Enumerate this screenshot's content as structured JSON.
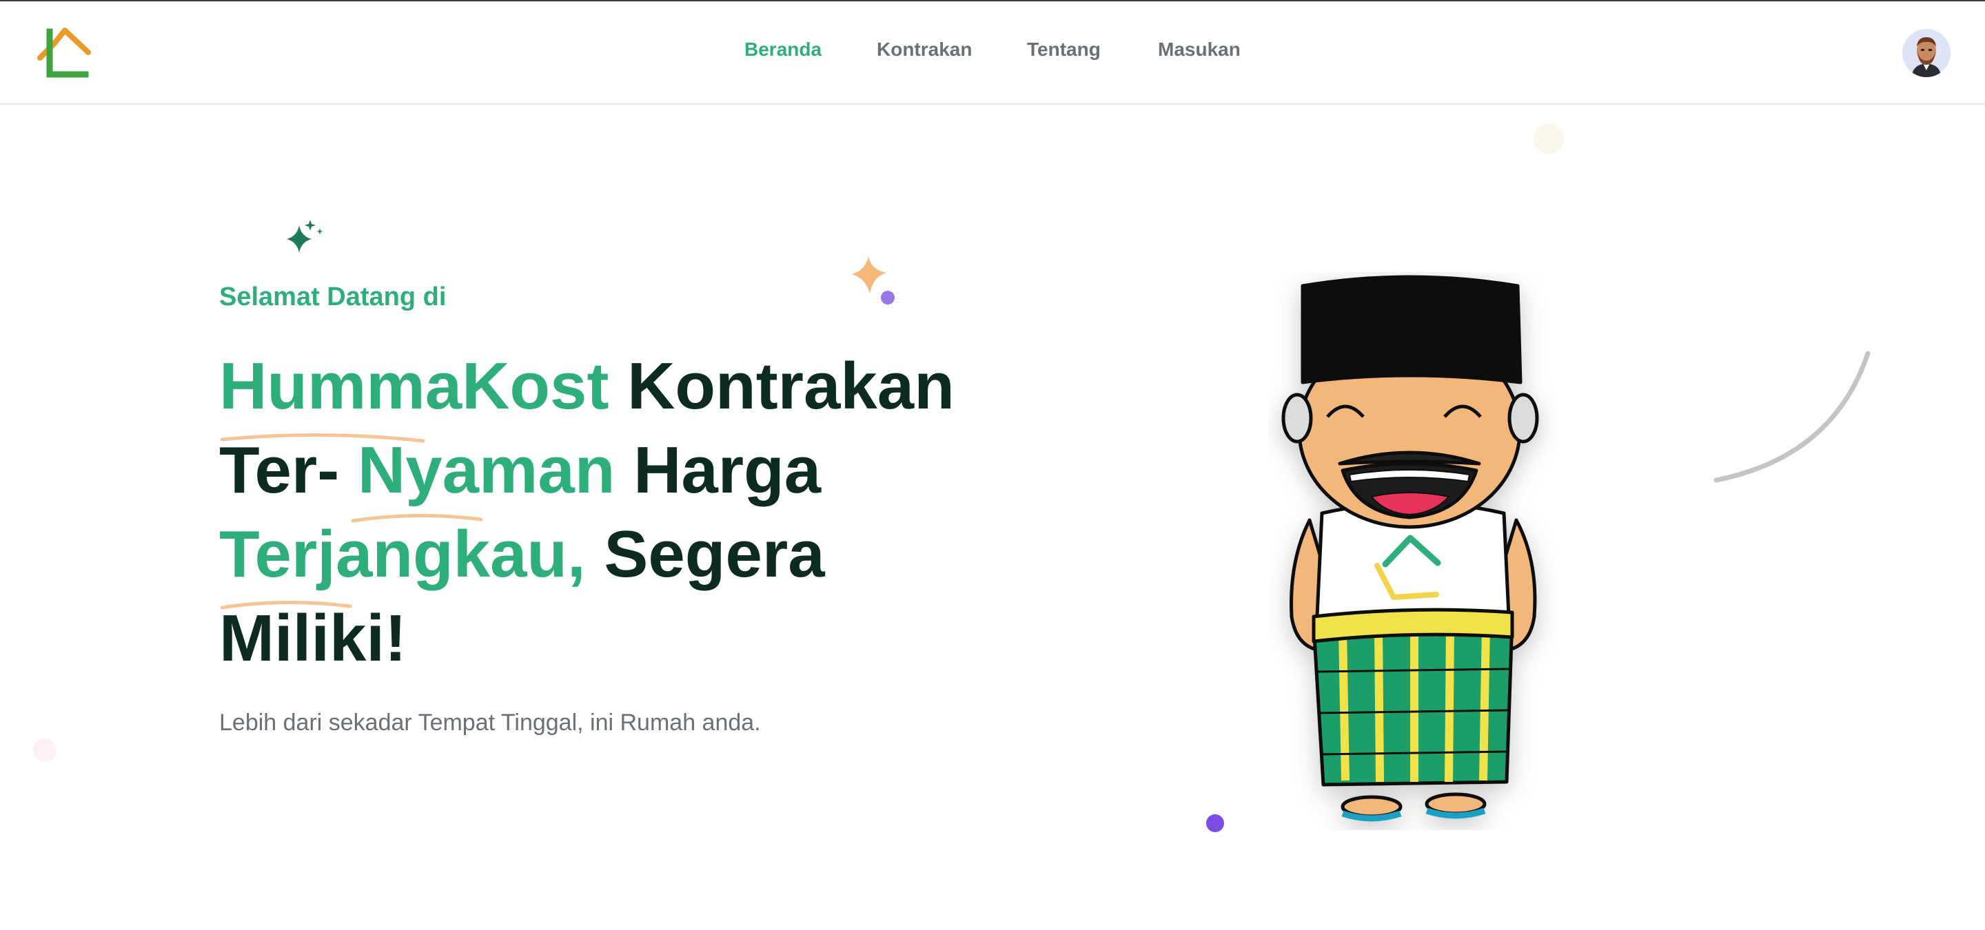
{
  "nav": {
    "items": [
      {
        "label": "Beranda",
        "active": true
      },
      {
        "label": "Kontrakan",
        "active": false
      },
      {
        "label": "Tentang",
        "active": false
      },
      {
        "label": "Masukan",
        "active": false
      }
    ]
  },
  "hero": {
    "welcome": "Selamat Datang di",
    "headline": {
      "brand": "HummaKost",
      "word2": "Kontrakan",
      "word3": "Ter-",
      "word4": "Nyaman",
      "word5": "Harga",
      "word6": "Terjangkau,",
      "word7": "Segera",
      "word8": "Miliki!"
    },
    "subtitle": "Lebih dari sekadar Tempat Tinggal, ini Rumah anda."
  },
  "colors": {
    "accent": "#2eae7b",
    "dark_text": "#0d2b23",
    "muted_text": "#6b6f78",
    "logo_orange": "#e99a27",
    "logo_green": "#3fa33f",
    "purple_dot": "#7b4ce6"
  },
  "icons": [
    "house-logo-icon",
    "sparkle-icon",
    "star-icon",
    "avatar-icon"
  ]
}
